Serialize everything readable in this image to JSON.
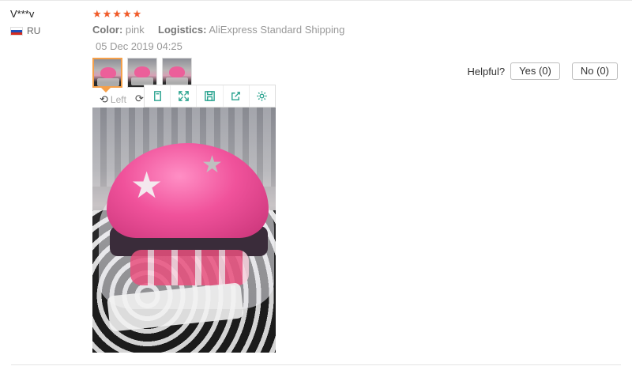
{
  "review": {
    "user": "V***v",
    "country": "RU",
    "stars": "★★★★★",
    "color_key": "Color:",
    "color_value": "pink",
    "logistics_key": "Logistics:",
    "logistics_value": "AliExpress Standard Shipping",
    "date": "05 Dec 2019 04:25"
  },
  "viewer": {
    "rotate_left_label": "Left",
    "toolbar": [
      "page-icon",
      "fullscreen-icon",
      "save-icon",
      "share-icon",
      "gear-icon"
    ]
  },
  "helpful": {
    "label": "Helpful?",
    "yes": "Yes (0)",
    "no": "No (0)"
  },
  "colors": {
    "star": "#f05a28",
    "active_thumb_border": "#f5a04a",
    "toolbar_icon": "#2aa38f"
  }
}
